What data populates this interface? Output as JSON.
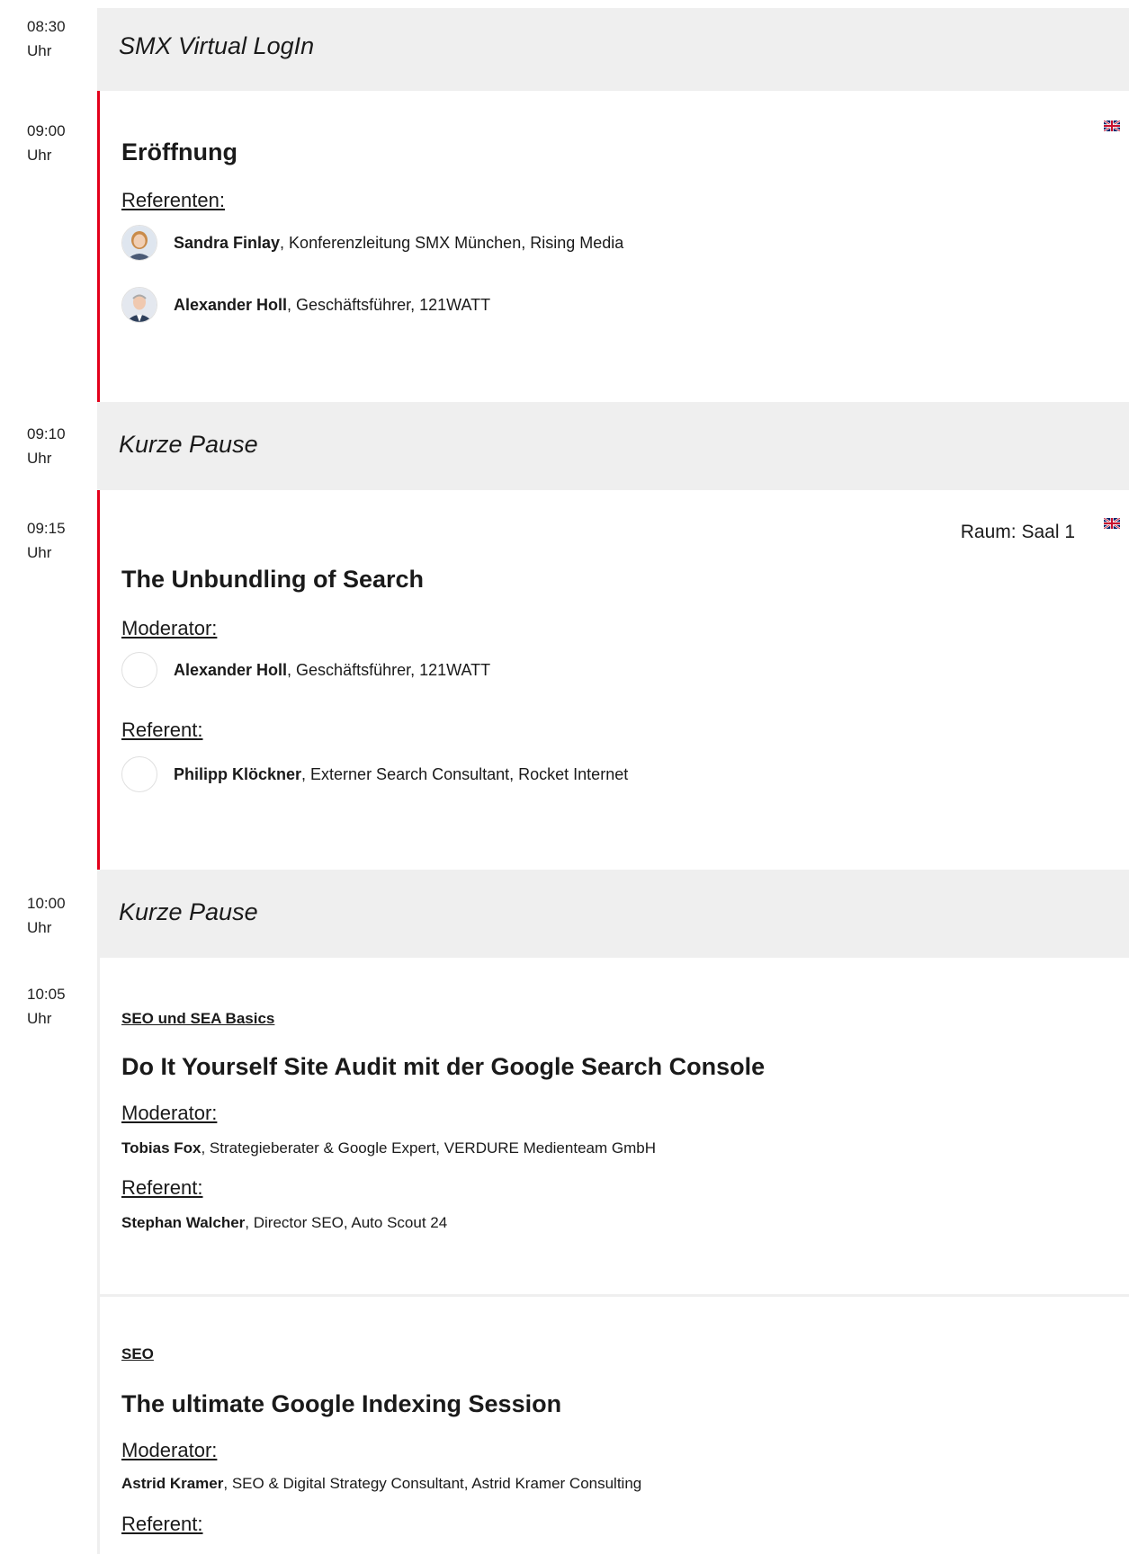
{
  "time_suffix": "Uhr",
  "rows": {
    "login": {
      "time": "08:30",
      "title": "SMX Virtual LogIn"
    },
    "opening": {
      "time": "09:00",
      "title": "Eröffnung",
      "role": "Referenten:",
      "speakers": [
        {
          "name": "Sandra Finlay",
          "detail": ", Konferenzleitung SMX München, Rising Media"
        },
        {
          "name": "Alexander Holl",
          "detail": ", Geschäftsführer, 121WATT"
        }
      ]
    },
    "pause1": {
      "time": "09:10",
      "title": "Kurze Pause"
    },
    "unbundling": {
      "time": "09:15",
      "room": "Raum: Saal 1",
      "title": "The Unbundling of Search",
      "moderator_role": "Moderator:",
      "moderator": {
        "name": "Alexander Holl",
        "detail": ", Geschäftsführer, 121WATT"
      },
      "speaker_role": "Referent:",
      "speaker": {
        "name": "Philipp Klöckner",
        "detail": ", Externer Search Consultant, Rocket Internet"
      }
    },
    "pause2": {
      "time": "10:00",
      "title": "Kurze Pause"
    },
    "parallel": {
      "time": "10:05",
      "sessions": [
        {
          "track": "SEO und SEA Basics",
          "title": "Do It Yourself Site Audit mit der Google Search Console",
          "moderator_role": "Moderator:",
          "moderator": {
            "name": "Tobias Fox",
            "detail": ", Strategieberater & Google Expert, VERDURE Medienteam GmbH"
          },
          "speaker_role": "Referent:",
          "speaker": {
            "name": "Stephan Walcher",
            "detail": ", Director SEO, Auto Scout 24"
          }
        },
        {
          "track": "SEO",
          "title": "The ultimate Google Indexing Session",
          "moderator_role": "Moderator:",
          "moderator": {
            "name": "Astrid Kramer",
            "detail": ", SEO & Digital Strategy Consultant, Astrid Kramer Consulting"
          },
          "speaker_role": "Referent:"
        }
      ]
    }
  },
  "icons": {
    "flag": "uk-flag-icon",
    "avatar": "speaker-avatar"
  },
  "colors": {
    "accent_red": "#e3001b",
    "pause_bg": "#efefef"
  }
}
